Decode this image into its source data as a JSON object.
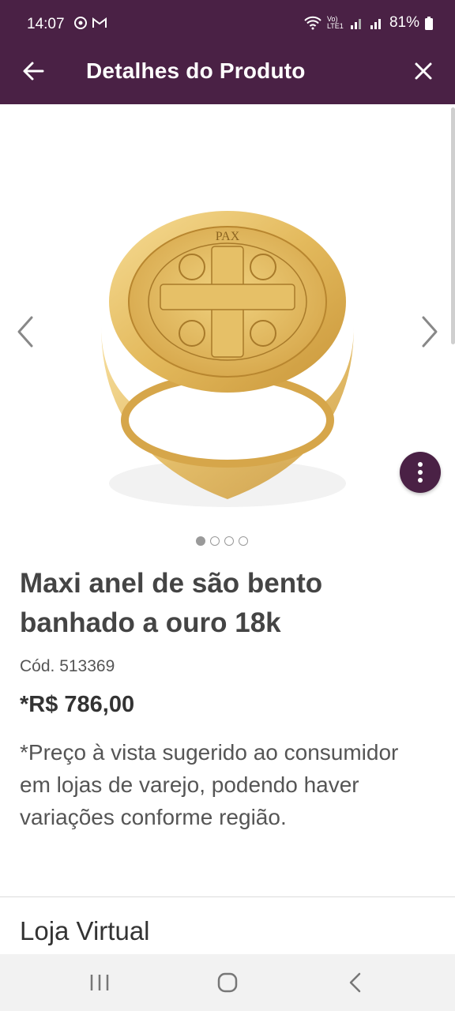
{
  "status_bar": {
    "time": "14:07",
    "network_label": "Vo) LTE1",
    "battery": "81%"
  },
  "app_bar": {
    "title": "Detalhes do Produto",
    "back_icon": "arrow-left-icon",
    "close_icon": "close-icon"
  },
  "gallery": {
    "image_count": 4,
    "active_index": 0,
    "medallion_text": "PAX",
    "prev_icon": "chevron-left-icon",
    "next_icon": "chevron-right-icon",
    "menu_icon": "more-vertical-icon"
  },
  "product": {
    "title": "Maxi anel de são bento banhado a ouro 18k",
    "code": "Cód. 513369",
    "price": "*R$ 786,00",
    "price_note": "*Preço à vista sugerido ao consumidor em lojas de varejo, podendo haver variações conforme região."
  },
  "section": {
    "title": "Loja Virtual"
  },
  "colors": {
    "brand": "#4a2145",
    "gold": "#e3b95c",
    "text_dark": "#444444"
  }
}
